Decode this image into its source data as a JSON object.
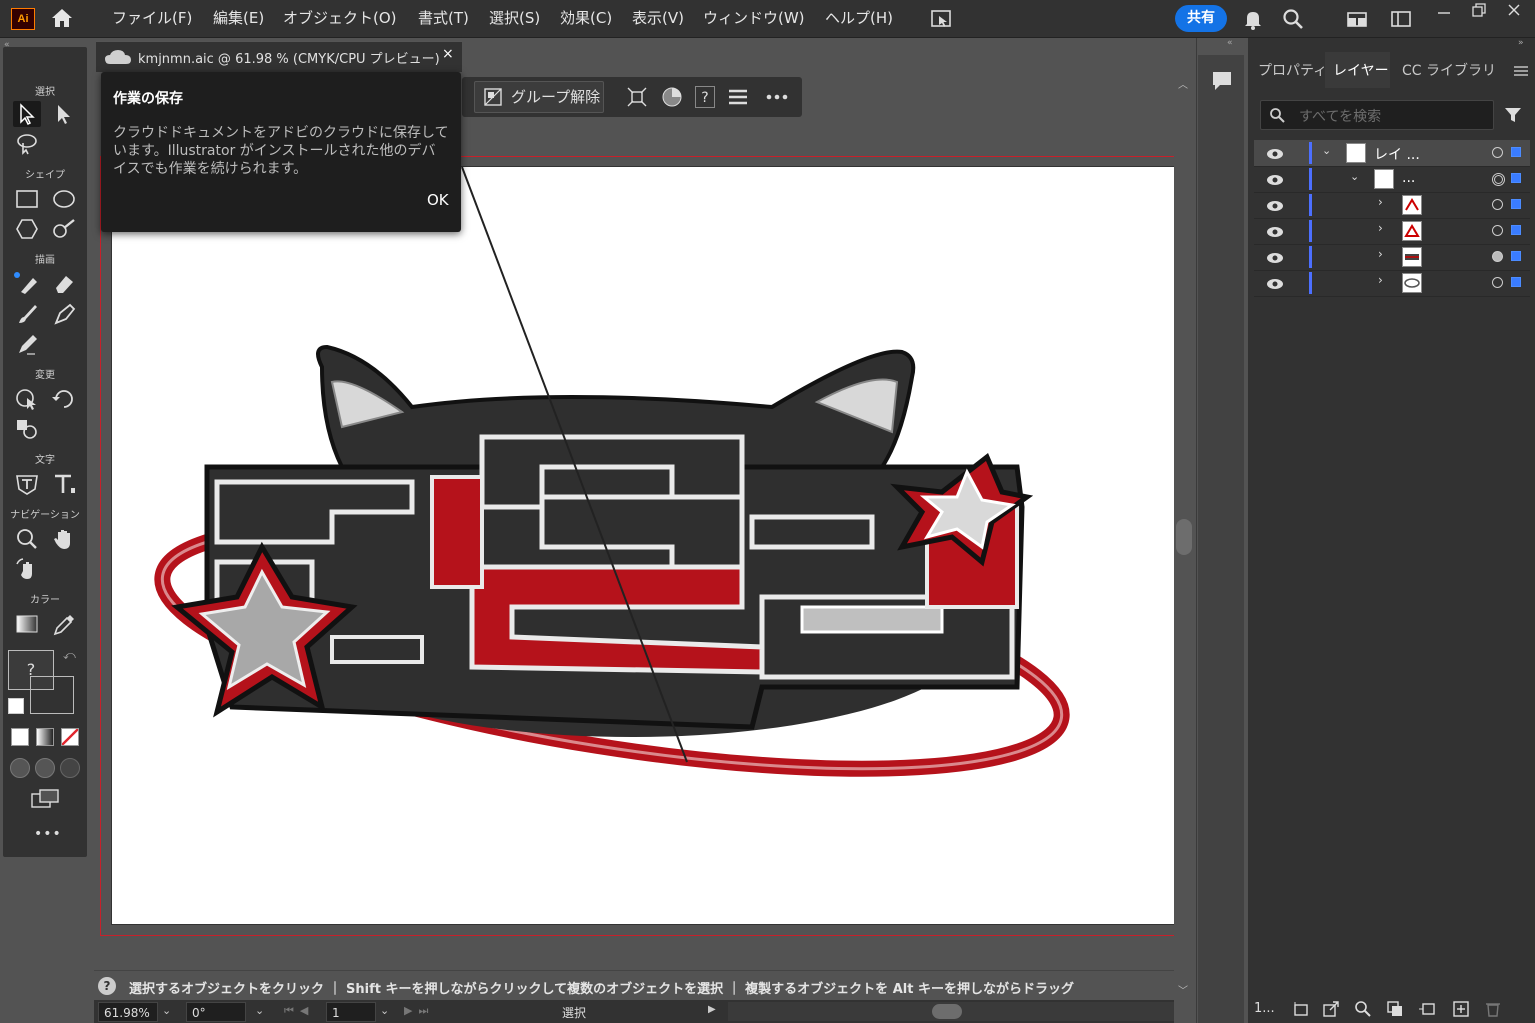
{
  "app": {
    "logo": "Ai"
  },
  "menubar": {
    "items": [
      "ファイル(F)",
      "編集(E)",
      "オブジェクト(O)",
      "書式(T)",
      "選択(S)",
      "効果(C)",
      "表示(V)",
      "ウィンドウ(W)",
      "ヘルプ(H)"
    ],
    "share_label": "共有"
  },
  "toolbar": {
    "groups": {
      "select": "選択",
      "shape": "シェイプ",
      "draw": "描画",
      "transform": "変更",
      "type": "文字",
      "navigation": "ナビゲーション",
      "color": "カラー"
    },
    "fill_placeholder": "?",
    "more": "•••"
  },
  "document": {
    "tab_title": "kmjnmn.aic @ 61.98 % (CMYK/CPU プレビュー)",
    "close": "×"
  },
  "context_toolbar": {
    "ungroup_label": "グループ解除",
    "help": "?"
  },
  "popover": {
    "title": "作業の保存",
    "body": "クラウドドキュメントをアドビのクラウドに保存しています。Illustrator がインストールされた他のデバイスでも作業を続けられます。",
    "ok_label": "OK"
  },
  "hintbar": {
    "icon": "?",
    "text": "選択するオブジェクトをクリック ｜ Shift キーを押しながらクリックして複数のオブジェクトを選択 ｜ 複製するオブジェクトを Alt キーを押しながらドラッグ"
  },
  "statusbar": {
    "zoom": "61.98%",
    "rotation": "0°",
    "artboard_num": "1",
    "mode": "選択"
  },
  "panel": {
    "tabs": [
      "プロパティ",
      "レイヤー",
      "CC ライブラリ"
    ],
    "active_tab": "レイヤー",
    "search_placeholder": "すべてを検索",
    "layers": [
      {
        "name": "レイ ..."
      },
      {
        "name": "..."
      },
      {
        "name": ""
      },
      {
        "name": ""
      },
      {
        "name": ""
      },
      {
        "name": ""
      }
    ],
    "footer_count": "1..."
  },
  "colors": {
    "accent": "#1473e6",
    "artboard_outline": "#c8202a",
    "layer_color": "#4c6fff"
  }
}
